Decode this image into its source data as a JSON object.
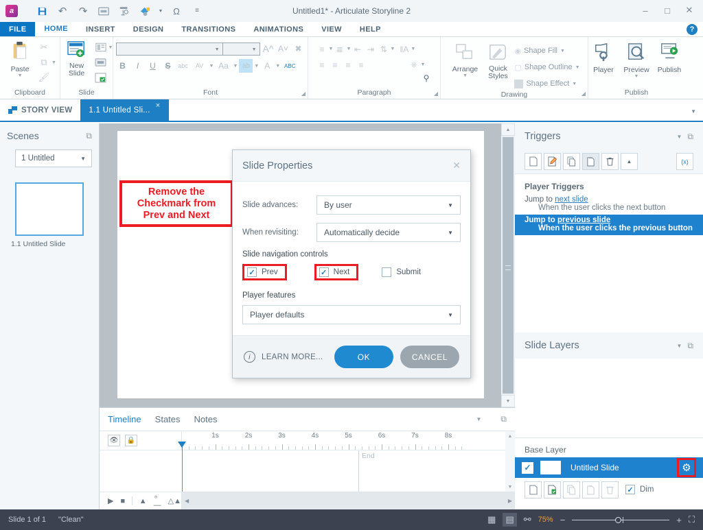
{
  "titlebar": {
    "app_logo": "a",
    "window_title": "Untitled1* - Articulate Storyline 2",
    "quick_access": [
      {
        "name": "save-icon",
        "glyph": "ὋE"
      },
      {
        "name": "undo-icon",
        "glyph": "↶"
      },
      {
        "name": "redo-icon",
        "glyph": "↷"
      },
      {
        "name": "textbox-icon",
        "glyph": "▭"
      },
      {
        "name": "form-icon",
        "glyph": "⎘"
      },
      {
        "name": "color-fill-icon",
        "glyph": "◔"
      },
      {
        "name": "symbol-omega-icon",
        "glyph": "Ω"
      },
      {
        "name": "customize-qat-icon",
        "glyph": "—"
      }
    ],
    "window_controls": {
      "minimize": "–",
      "maximize": "□",
      "close": "✕"
    },
    "help": "?"
  },
  "ribbon": {
    "tabs": [
      {
        "label": "FILE",
        "active": false
      },
      {
        "label": "HOME",
        "active": true
      },
      {
        "label": "INSERT",
        "active": false
      },
      {
        "label": "DESIGN",
        "active": false
      },
      {
        "label": "TRANSITIONS",
        "active": false
      },
      {
        "label": "ANIMATIONS",
        "active": false
      },
      {
        "label": "VIEW",
        "active": false
      },
      {
        "label": "HELP",
        "active": false
      }
    ],
    "groups": {
      "clipboard": {
        "label": "Clipboard",
        "paste": "Paste",
        "cut": "Cut",
        "copy": "Copy",
        "format_painter": "Format Painter"
      },
      "slide": {
        "label": "Slide",
        "new_slide": "New\nSlide",
        "new_slide_line1": "New",
        "new_slide_line2": "Slide"
      },
      "font": {
        "label": "Font",
        "font_name_value": "",
        "font_size_value": "",
        "bold": "B",
        "italic": "I",
        "underline": "U",
        "strikethrough": "S",
        "small_caps": "abc",
        "char_spacing": "AV",
        "change_case": "Aa",
        "highlight": "ab",
        "font_color": "A",
        "spelling": "ABC",
        "grow_font": "A",
        "shrink_font": "A",
        "clear_format": "✐"
      },
      "paragraph": {
        "label": "Paragraph"
      },
      "drawing": {
        "label": "Drawing",
        "arrange": "Arrange",
        "quick_styles_line1": "Quick",
        "quick_styles_line2": "Styles",
        "shape_fill": "Shape Fill",
        "shape_outline": "Shape Outline",
        "shape_effect": "Shape Effect"
      },
      "publish": {
        "label": "Publish",
        "player": "Player",
        "preview": "Preview",
        "publish": "Publish"
      }
    }
  },
  "doctabs": {
    "story_view": "STORY VIEW",
    "slide_tab": "1.1 Untitled Sli...",
    "close_glyph": "×"
  },
  "scenes": {
    "title": "Scenes",
    "scene_select": "1 Untitled",
    "slide_label": "1.1 Untitled Slide"
  },
  "annotation": {
    "line1": "Remove the",
    "line2": "Checkmark from",
    "line3": "Prev and Next",
    "color": "#ed1c24"
  },
  "dialog": {
    "title": "Slide Properties",
    "close": "✕",
    "fields": [
      {
        "label": "Slide advances:",
        "value": "By user"
      },
      {
        "label": "When revisiting:",
        "value": "Automatically decide"
      }
    ],
    "nav_section_label": "Slide navigation controls",
    "checkboxes": [
      {
        "label": "Prev",
        "checked": true,
        "highlighted": true
      },
      {
        "label": "Next",
        "checked": true,
        "highlighted": true
      },
      {
        "label": "Submit",
        "checked": false,
        "highlighted": false
      }
    ],
    "player_features_label": "Player features",
    "player_features_value": "Player defaults",
    "learn_more": "LEARN MORE...",
    "ok": "OK",
    "cancel": "CANCEL"
  },
  "timeline": {
    "tabs": [
      {
        "label": "Timeline",
        "active": true
      },
      {
        "label": "States",
        "active": false
      },
      {
        "label": "Notes",
        "active": false
      }
    ],
    "seconds": [
      "1s",
      "2s",
      "3s",
      "4s",
      "5s",
      "6s",
      "7s",
      "8s"
    ],
    "end_label": "End"
  },
  "triggers": {
    "title": "Triggers",
    "toolbar": [
      {
        "name": "new-trigger-icon",
        "glyph": "☐"
      },
      {
        "name": "edit-trigger-icon",
        "glyph": "✎"
      },
      {
        "name": "copy-trigger-icon",
        "glyph": "⧉"
      },
      {
        "name": "paste-trigger-icon",
        "glyph": "❐"
      },
      {
        "name": "delete-trigger-icon",
        "glyph": "🗑"
      },
      {
        "name": "move-up-icon",
        "glyph": "▲"
      },
      {
        "name": "variables-icon",
        "glyph": "(x)"
      }
    ],
    "section_label": "Player Triggers",
    "rows": [
      {
        "action": "Jump to",
        "target": "next slide",
        "condition": "When the user clicks the next button",
        "selected": false
      },
      {
        "action": "Jump to",
        "target": "previous slide",
        "condition": "When the user clicks the previous button",
        "selected": true
      }
    ]
  },
  "slide_layers": {
    "title": "Slide Layers",
    "base_layer_label": "Base Layer",
    "layer_name": "Untitled Slide",
    "gear_icon": "⚙",
    "dim_label": "Dim",
    "dim_checked": true,
    "tools": [
      {
        "name": "new-layer-icon",
        "glyph": "☐"
      },
      {
        "name": "edit-layer-icon",
        "glyph": "❑"
      },
      {
        "name": "copy-layer-icon",
        "glyph": "⧉"
      },
      {
        "name": "paste-layer-icon",
        "glyph": "❐"
      },
      {
        "name": "delete-layer-icon",
        "glyph": "🗑"
      }
    ]
  },
  "statusbar": {
    "slide_count": "Slide 1 of 1",
    "theme": "\"Clean\"",
    "zoom_pct": "75%",
    "zoom_minus": "−",
    "zoom_plus": "+",
    "view_icons": [
      {
        "name": "story-view-icon",
        "glyph": "∷",
        "active": false
      },
      {
        "name": "slide-view-icon",
        "glyph": "▤",
        "active": true
      },
      {
        "name": "form-view-icon",
        "glyph": "☷",
        "active": false
      }
    ],
    "fit_icon": "⛶"
  }
}
